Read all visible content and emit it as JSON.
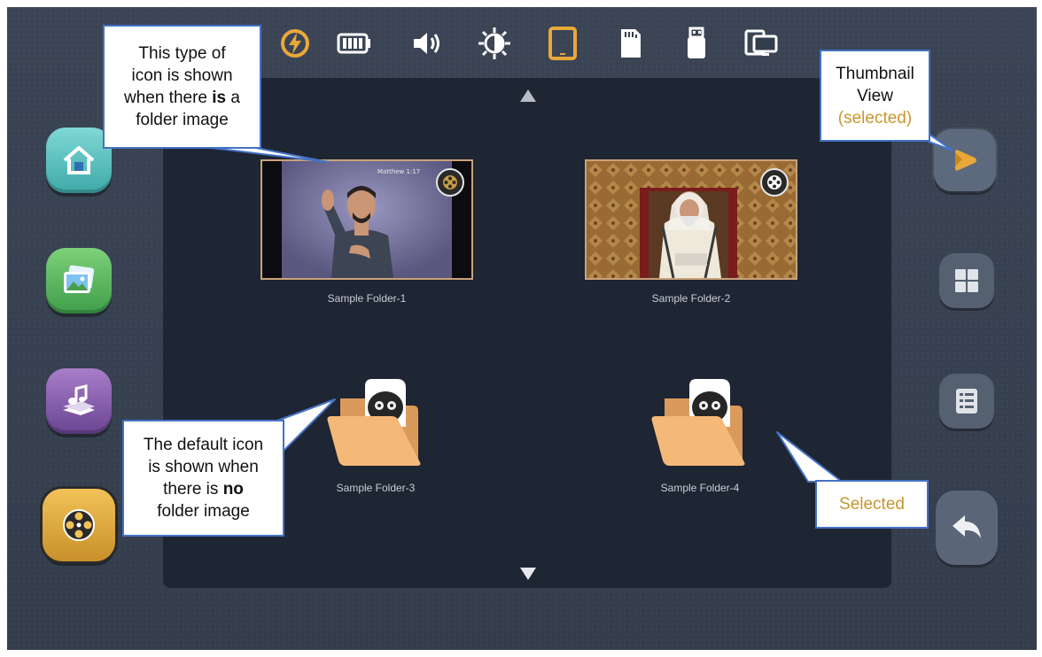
{
  "status_bar": {
    "icons": [
      "power-icon",
      "battery-icon",
      "volume-icon",
      "brightness-icon",
      "tablet-icon",
      "sd-card-icon",
      "usb-drive-icon",
      "display-icon"
    ],
    "active_icon": "tablet-icon",
    "accent_color": "#e9a83a"
  },
  "thumbnail_caption": "Matthew 1:17",
  "folders": [
    {
      "label": "Sample Folder-1",
      "type": "image",
      "icon": "film-reel-icon"
    },
    {
      "label": "Sample Folder-2",
      "type": "image",
      "icon": "film-reel-icon"
    },
    {
      "label": "Sample Folder-3",
      "type": "default",
      "icon": "folder-icon"
    },
    {
      "label": "Sample Folder-4",
      "type": "default",
      "icon": "folder-icon",
      "selected": true
    }
  ],
  "left_nav": {
    "items": [
      "home-icon",
      "gallery-icon",
      "music-icon",
      "video-icon"
    ],
    "active": "video-icon"
  },
  "right_nav": {
    "items": [
      "thumbnail-view-icon",
      "grid-view-icon",
      "list-view-icon",
      "back-icon"
    ],
    "selected": "thumbnail-view-icon"
  },
  "callouts": {
    "folder_image": {
      "line1": "This type of",
      "line2": "icon is shown",
      "line3_pre": "when there ",
      "line3_bold": "is",
      "line3_post": " a",
      "line4": "folder image"
    },
    "default_icon": {
      "line1": "The default icon",
      "line2": "is shown when",
      "line3_pre": "there is ",
      "line3_bold": "no",
      "line4": "folder image"
    },
    "thumbnail_view": {
      "line1": "Thumbnail",
      "line2": "View",
      "line3": "(selected)"
    },
    "selected": {
      "text": "Selected"
    }
  },
  "colors": {
    "callout_border": "#4472c4",
    "callout_highlight": "#c9962e",
    "panel_bg": "#1e2533",
    "folder": "#f4b878"
  }
}
